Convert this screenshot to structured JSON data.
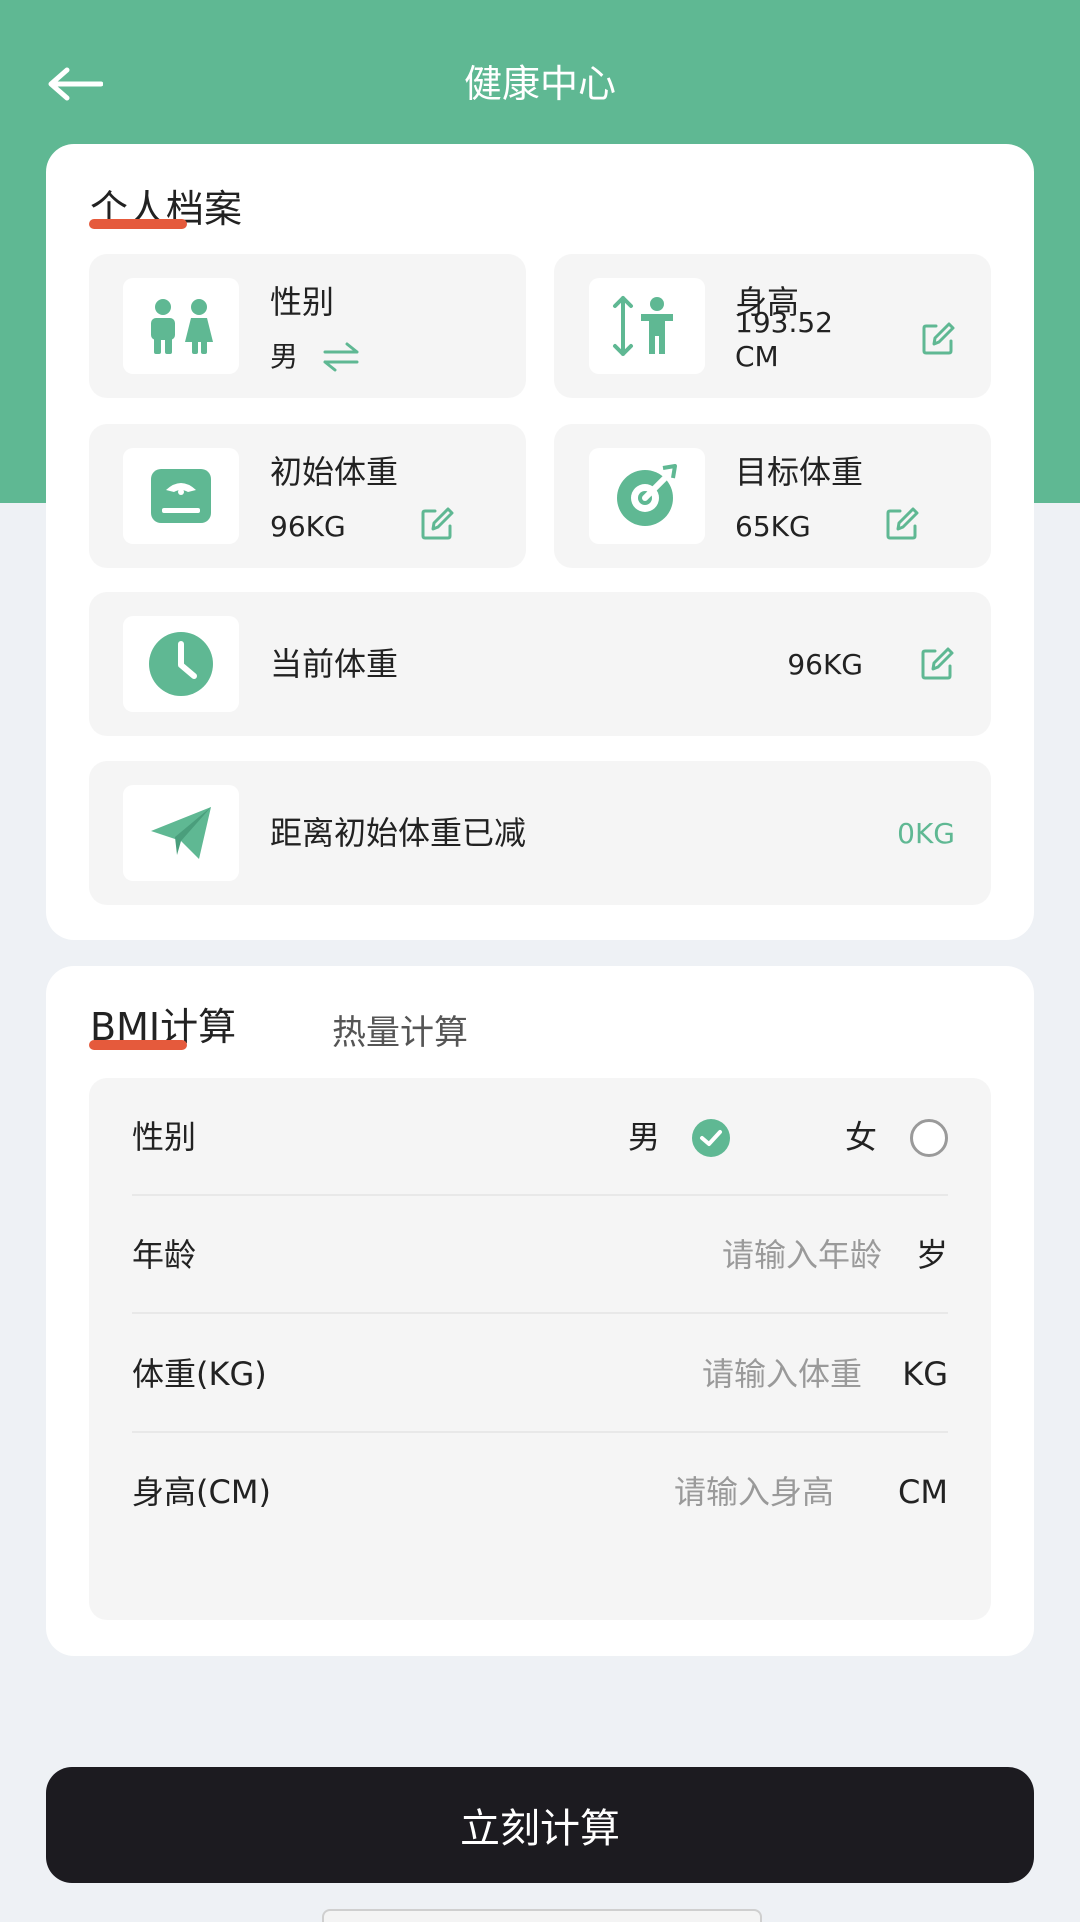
{
  "header": {
    "title": "健康中心",
    "back_icon": "arrow-left-icon"
  },
  "profile": {
    "title": "个人档案",
    "gender": {
      "label": "性别",
      "value": "男",
      "icon": "people-icon",
      "action_icon": "swap-icon"
    },
    "height": {
      "label": "身高",
      "value_line1": "193.52",
      "value_line2": "CM",
      "icon": "height-icon"
    },
    "initial_weight": {
      "label": "初始体重",
      "value": "96KG",
      "icon": "scale-icon"
    },
    "target_weight": {
      "label": "目标体重",
      "value": "65KG",
      "icon": "target-icon"
    },
    "current_weight": {
      "label": "当前体重",
      "value": "96KG",
      "icon": "clock-icon"
    },
    "lost": {
      "label": "距离初始体重已减",
      "value": "0KG",
      "icon": "paper-plane-icon"
    }
  },
  "bmi": {
    "tabs": [
      "BMI计算",
      "热量计算"
    ],
    "gender": {
      "label": "性别",
      "options": [
        "男",
        "女"
      ],
      "selected": "男"
    },
    "age": {
      "label": "年龄",
      "placeholder": "请输入年龄",
      "unit": "岁"
    },
    "weight": {
      "label": "体重(KG)",
      "placeholder": "请输入体重",
      "unit": "KG"
    },
    "height": {
      "label": "身高(CM)",
      "placeholder": "请输入身高",
      "unit": "CM"
    }
  },
  "calculate_button": "立刻计算",
  "colors": {
    "accent": "#5fb893",
    "underline": "#e55a3c",
    "button": "#1c1b20"
  }
}
